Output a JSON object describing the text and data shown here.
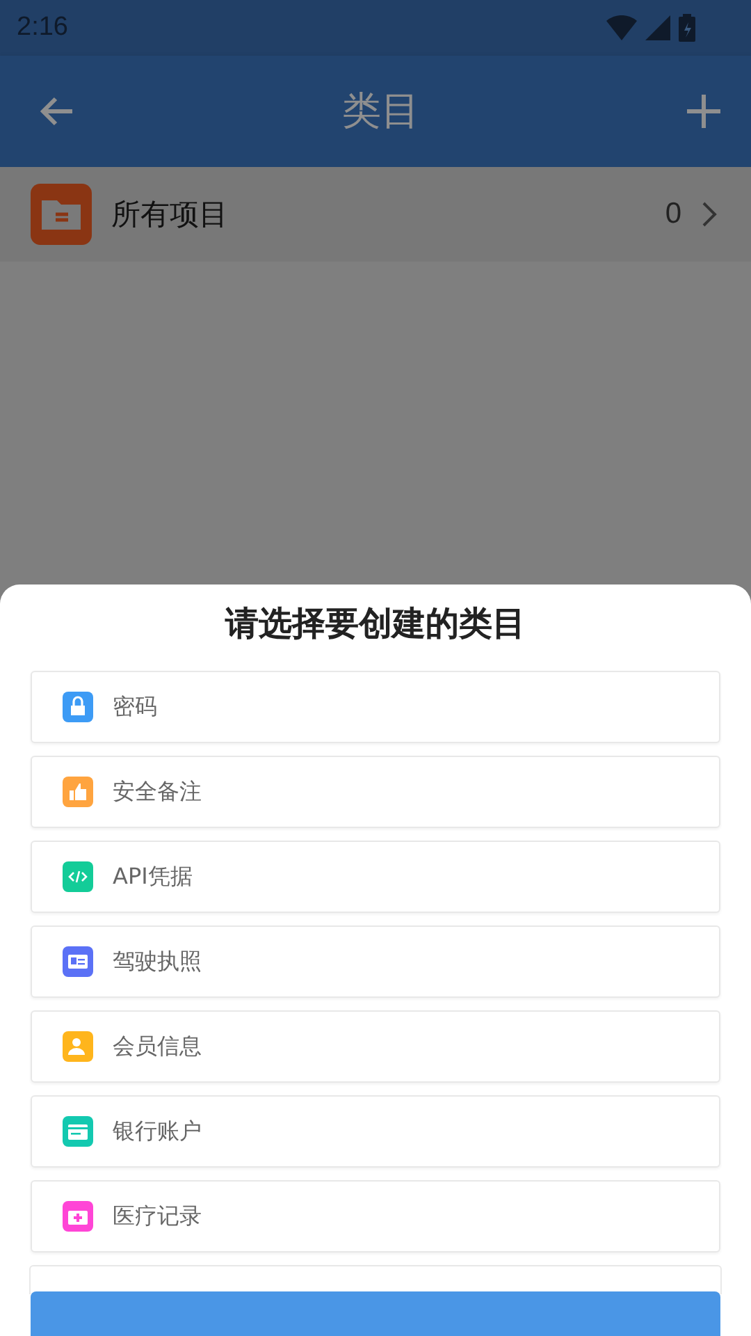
{
  "status_bar": {
    "time": "2:16"
  },
  "app_bar": {
    "title": "类目"
  },
  "categories": [
    {
      "name": "所有项目",
      "count": "0"
    }
  ],
  "sheet": {
    "title": "请选择要创建的类目",
    "options": [
      {
        "kind": "lock",
        "label": "密码",
        "color": "#3d9bf5"
      },
      {
        "kind": "thumb",
        "label": "安全备注",
        "color": "#ffa43f"
      },
      {
        "kind": "code",
        "label": "API凭据",
        "color": "#13cc98"
      },
      {
        "kind": "card",
        "label": "驾驶执照",
        "color": "#5b71f6"
      },
      {
        "kind": "person",
        "label": "会员信息",
        "color": "#ffb51c"
      },
      {
        "kind": "bank",
        "label": "银行账户",
        "color": "#13c9b0"
      },
      {
        "kind": "medical",
        "label": "医疗记录",
        "color": "#ff45d6"
      }
    ]
  }
}
